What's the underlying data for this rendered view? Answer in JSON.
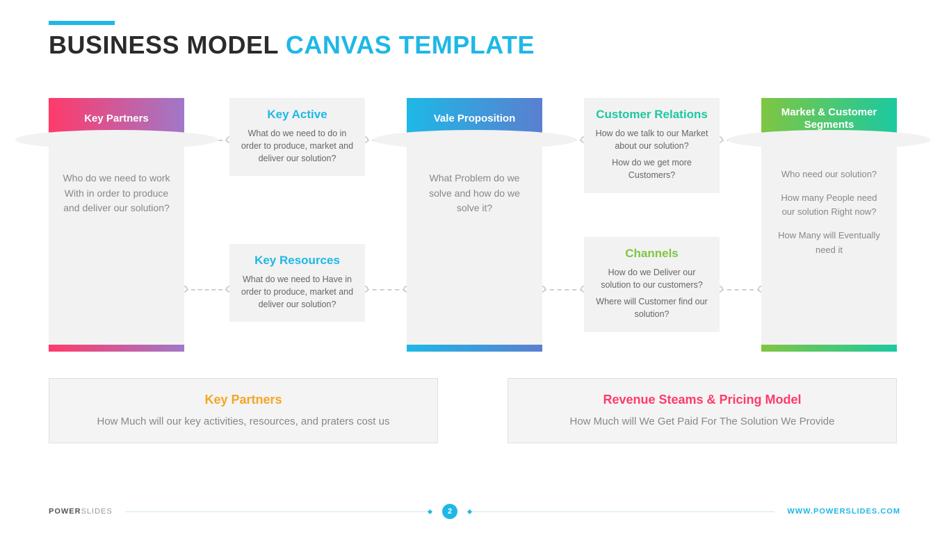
{
  "title": {
    "part1": "BUSINESS MODEL ",
    "part2": "CANVAS TEMPLATE"
  },
  "columns": {
    "keyPartners": {
      "label": "Key Partners",
      "body": "Who do we need to work With in order to produce and deliver our solution?"
    },
    "valueProp": {
      "label": "Vale Proposition",
      "body": "What Problem do we solve and how do we solve it?"
    },
    "segments": {
      "label": "Market & Customer Segments",
      "q1": "Who need our solution?",
      "q2": "How many People need our solution Right now?",
      "q3": "How Many will Eventually need it"
    }
  },
  "boxes": {
    "keyActive": {
      "title": "Key Active",
      "text": "What do we need to do in order to produce, market and deliver our solution?"
    },
    "keyResources": {
      "title": "Key Resources",
      "text": "What do we need to Have in order to produce, market and deliver our solution?"
    },
    "customerRelations": {
      "title": "Customer Relations",
      "q1": "How do we talk to our Market about our solution?",
      "q2": "How do we get more Customers?"
    },
    "channels": {
      "title": "Channels",
      "q1": "How do we Deliver our solution to our customers?",
      "q2": "Where will Customer find our solution?"
    }
  },
  "bottom": {
    "cost": {
      "title": "Key Partners",
      "text": "How Much will our key activities, resources, and praters cost us"
    },
    "revenue": {
      "title": "Revenue Steams & Pricing Model",
      "text": "How Much will We Get Paid For The Solution We Provide"
    }
  },
  "footer": {
    "brandBold": "POWER",
    "brandLight": "SLIDES",
    "page": "2",
    "url": "WWW.POWERSLIDES.COM"
  }
}
